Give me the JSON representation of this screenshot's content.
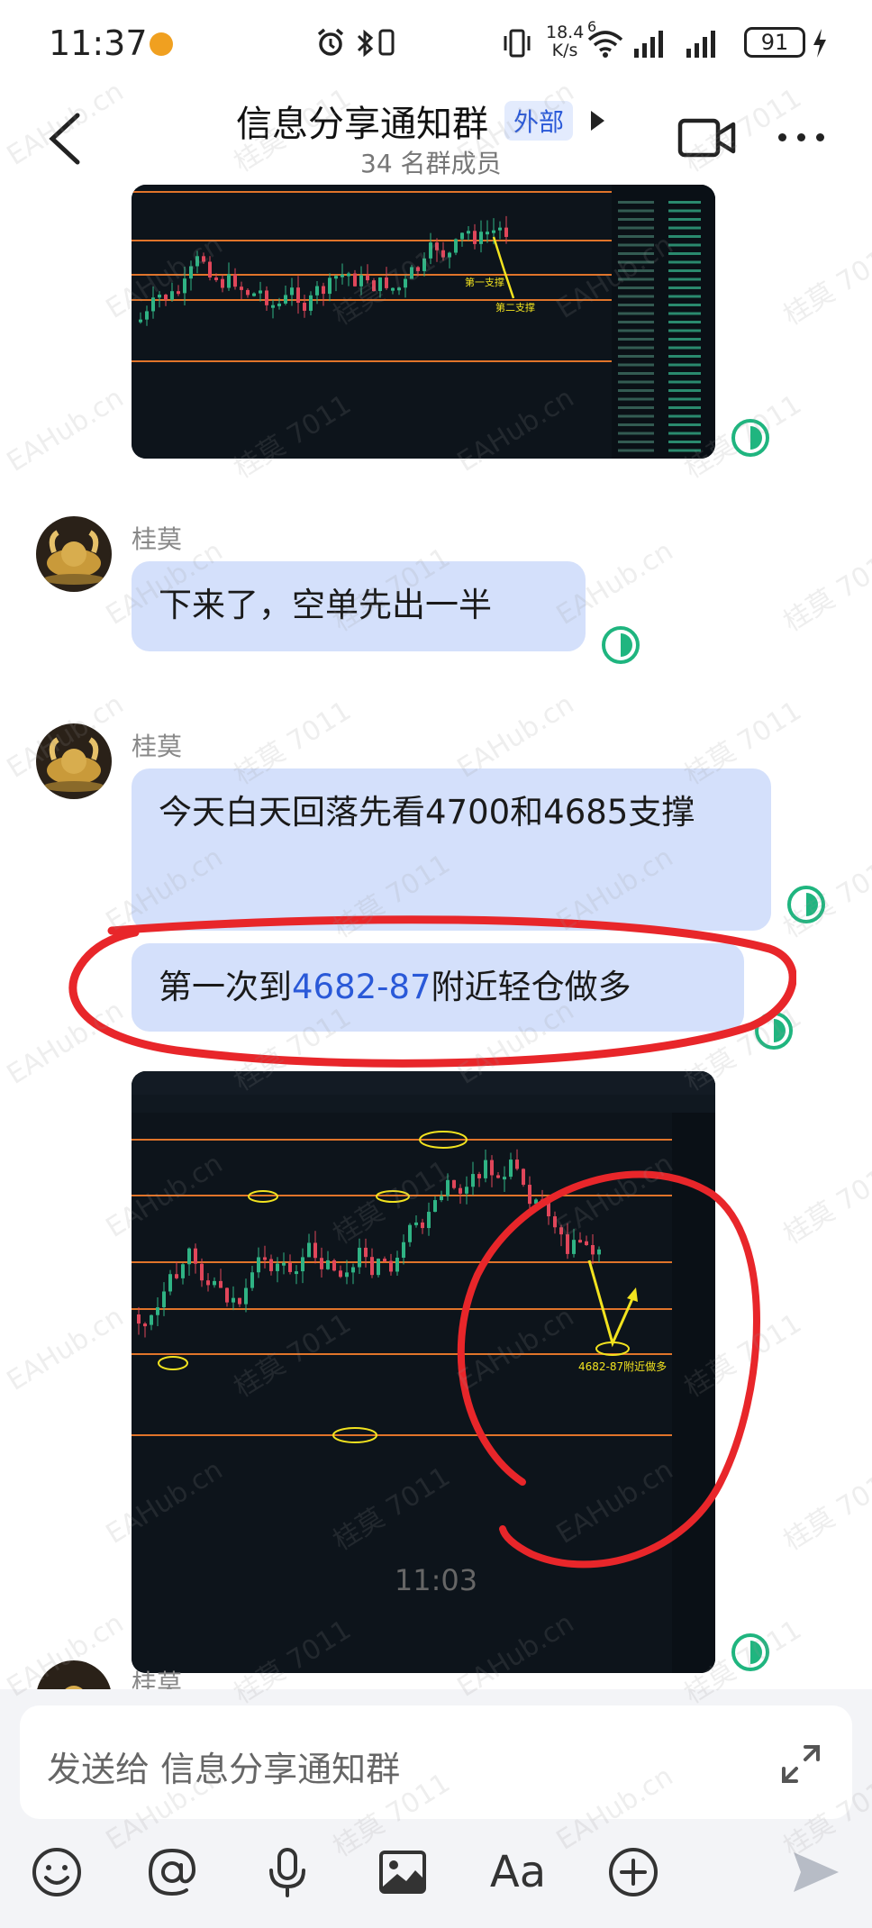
{
  "status_bar": {
    "time": "11:37",
    "net_speed_value": "18.4",
    "net_speed_unit": "K/s",
    "wifi_badge": "6",
    "battery": "91"
  },
  "header": {
    "title": "信息分享通知群",
    "external_tag": "外部",
    "member_count": "34 名群成员",
    "icons": [
      "back-icon",
      "video-call-icon",
      "more-icon"
    ]
  },
  "messages": [
    {
      "type": "image",
      "chart_labels": [
        "第一支撑",
        "第二支撑"
      ]
    },
    {
      "type": "text",
      "sender": "桂莫",
      "text": "下来了，空单先出一半"
    },
    {
      "type": "text",
      "sender": "桂莫",
      "text": "今天白天回落先看4700和4685支撑"
    },
    {
      "type": "text",
      "sender": "桂莫",
      "text_before": "第一次到",
      "text_number": "4682-87",
      "text_after": "附近轻仓做多"
    },
    {
      "type": "image",
      "chart_labels": [
        "4682-87附近做多"
      ]
    }
  ],
  "timestamp": "11:03",
  "partial_sender": "桂莫",
  "input": {
    "placeholder": "发送给 信息分享通知群"
  },
  "toolbar": {
    "font_label": "Aa",
    "icons": [
      "emoji-icon",
      "mention-icon",
      "microphone-icon",
      "image-icon",
      "font-icon",
      "plus-icon",
      "send-icon"
    ]
  },
  "watermark_texts": [
    "EAHub.cn",
    "桂莫 7011"
  ],
  "colors": {
    "bubble": "#d4e0fb",
    "link_number": "#2a59d8",
    "read_icon": "#1fb57f",
    "annotation_red": "#e8262a"
  }
}
